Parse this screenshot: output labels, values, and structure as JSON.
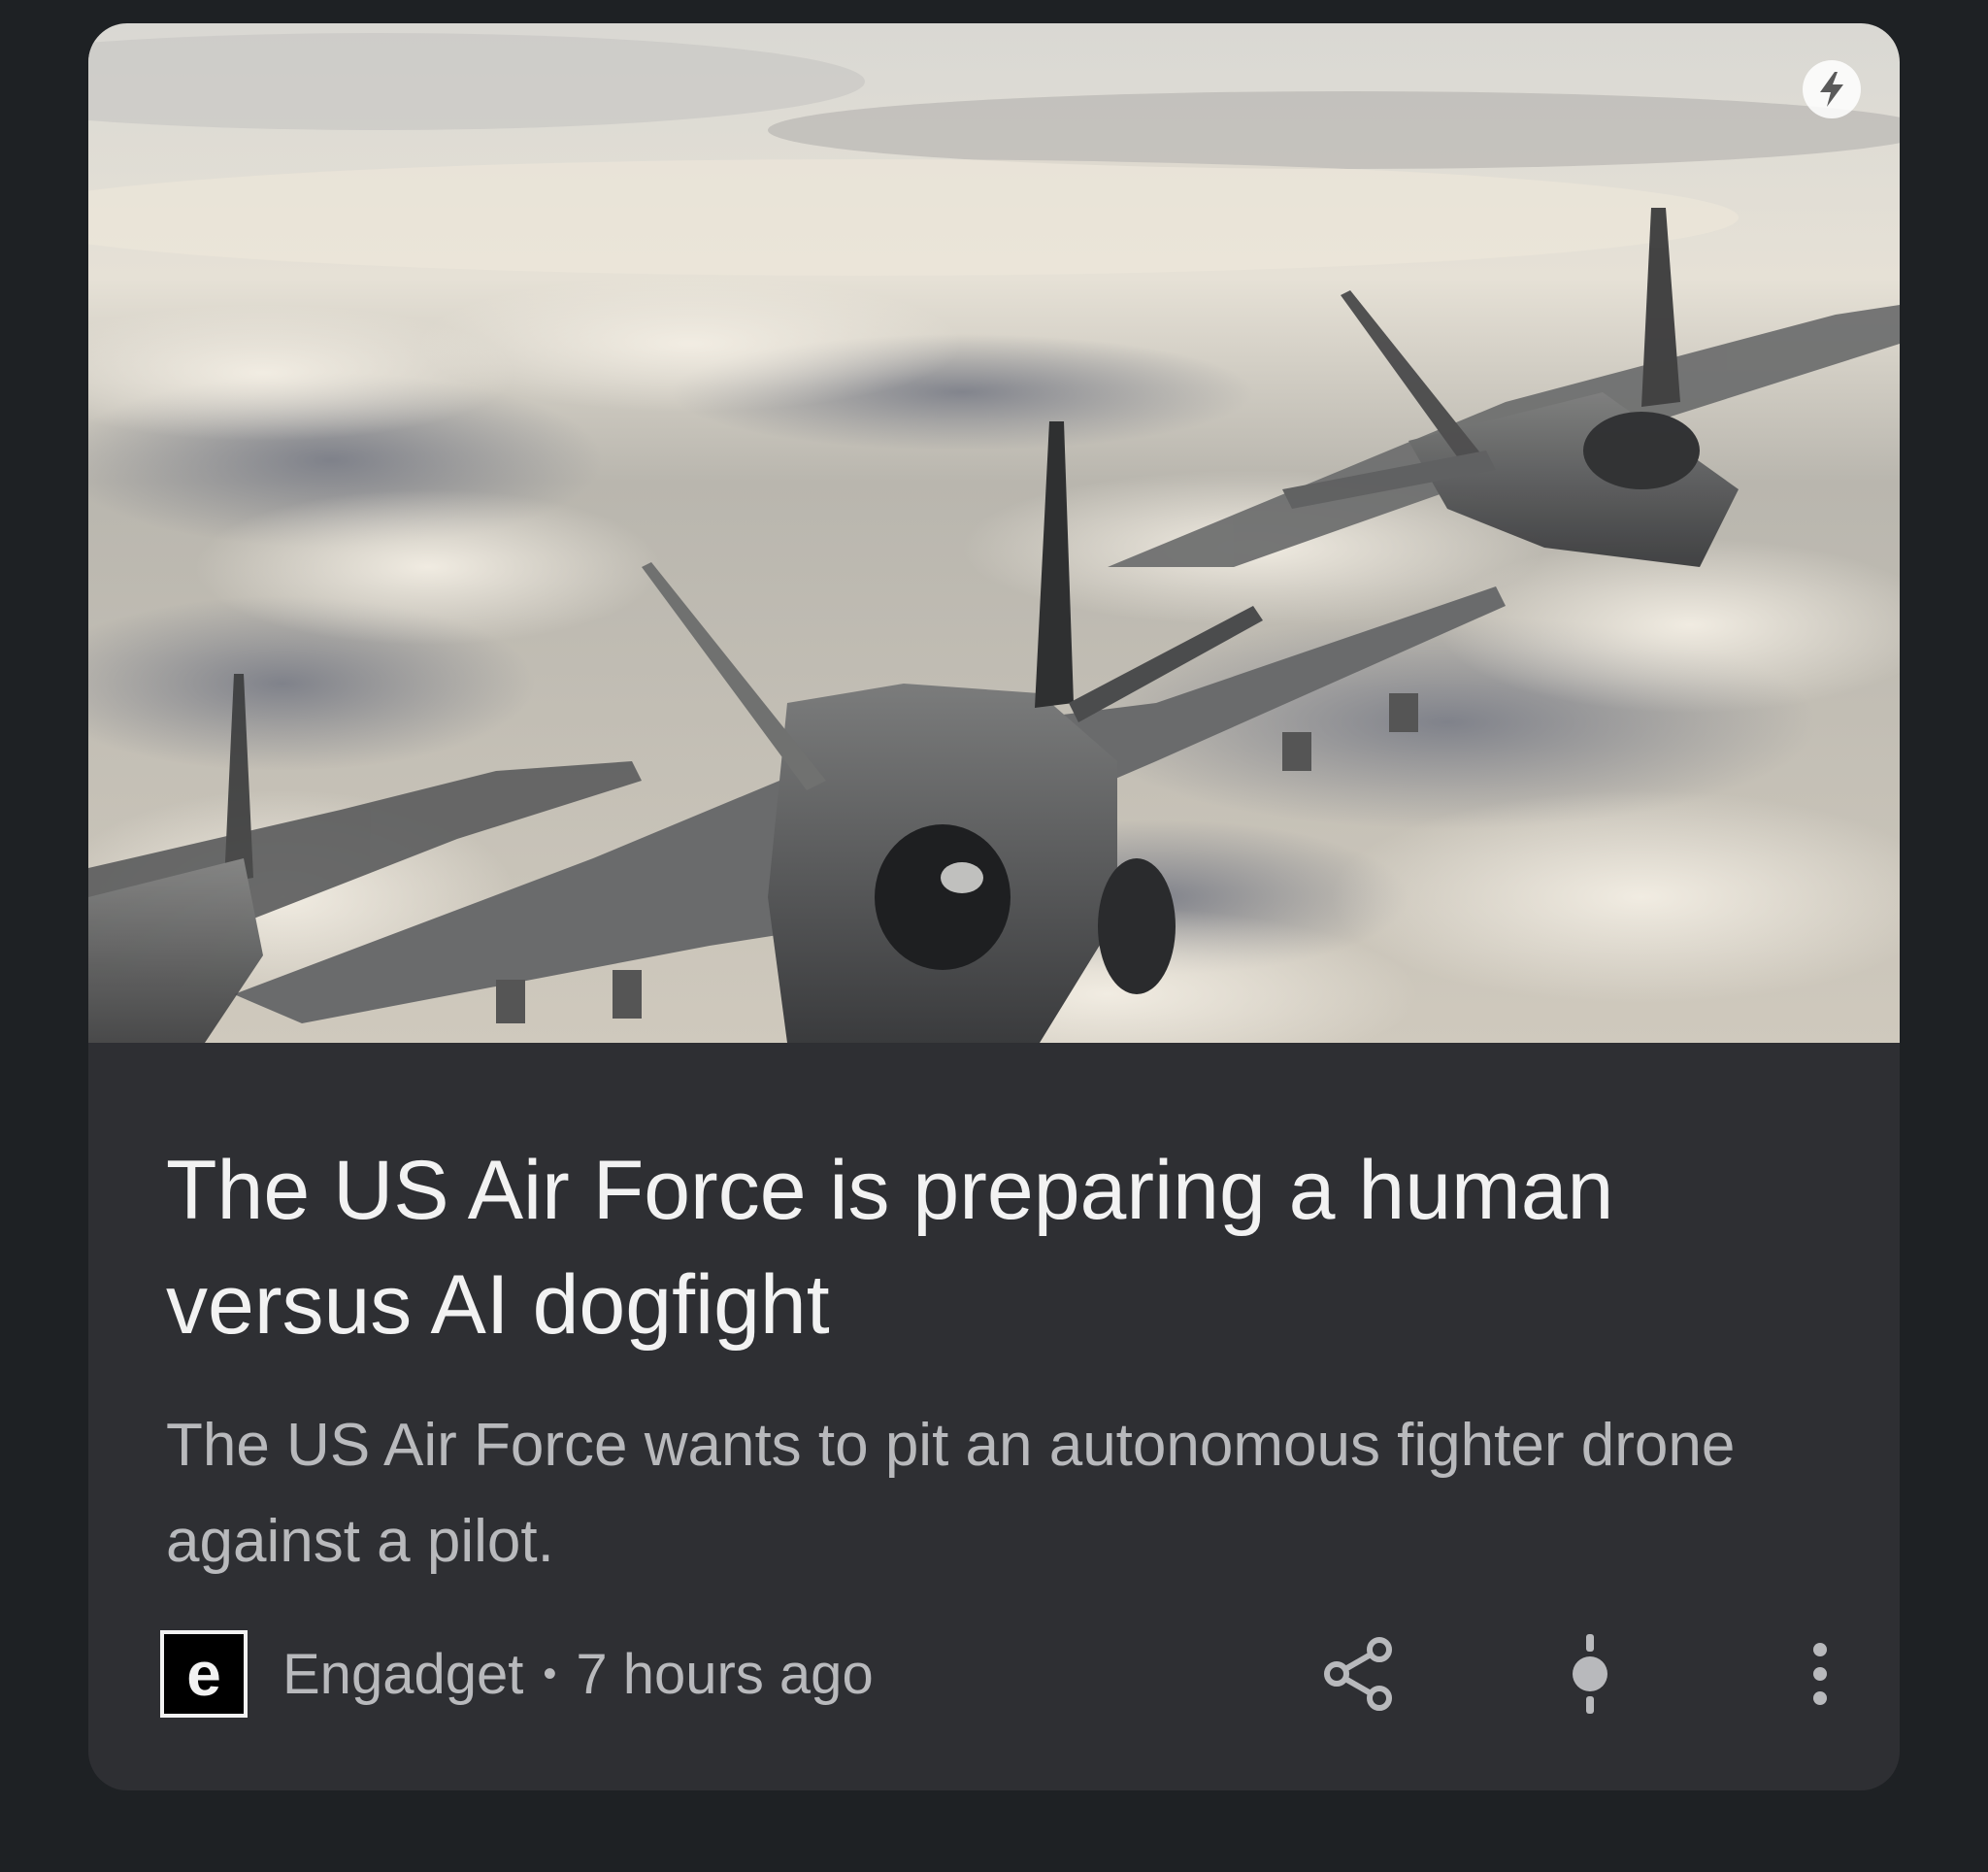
{
  "article": {
    "headline": "The US Air Force is preparing a human versus AI dogfight",
    "snippet": "The US Air Force wants to pit an autonomous fighter drone against a pilot.",
    "source_logo_letter": "e",
    "source": "Engadget",
    "separator": "•",
    "age": "7 hours ago"
  },
  "icons": {
    "amp": "lightning-bolt-icon",
    "share": "share-icon",
    "full_coverage": "full-coverage-icon",
    "more": "more-vert-icon"
  },
  "colors": {
    "background": "#1e2124",
    "card": "#2e2f33",
    "headline": "#f2f2f2",
    "secondary_text": "#b8b9bc"
  }
}
